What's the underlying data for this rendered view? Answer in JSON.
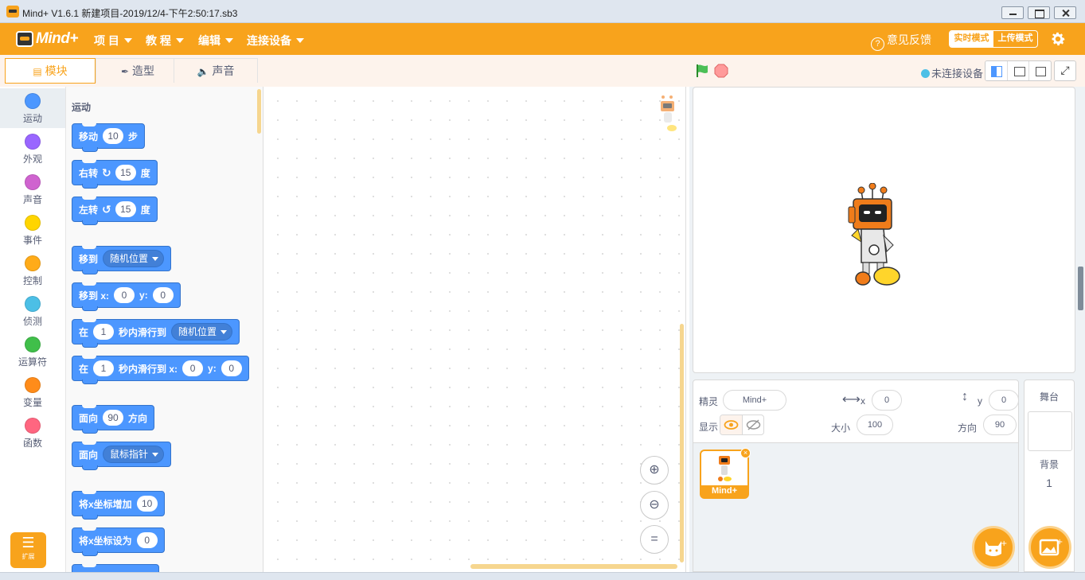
{
  "window": {
    "title": "Mind+ V1.6.1      新建项目-2019/12/4-下午2:50:17.sb3"
  },
  "menubar": {
    "logo_text": "Mind+",
    "items": [
      {
        "label": "项 目"
      },
      {
        "label": "教 程"
      },
      {
        "label": "编辑"
      },
      {
        "label": "连接设备"
      }
    ],
    "feedback_label": "意见反馈",
    "mode_realtime": "实时模式",
    "mode_upload": "上传模式",
    "accent_color": "#f8a31c"
  },
  "tabs": [
    {
      "label": "模块",
      "icon": "blocks-icon",
      "active": true
    },
    {
      "label": "造型",
      "icon": "brush-icon",
      "active": false
    },
    {
      "label": "声音",
      "icon": "speaker-icon",
      "active": false
    }
  ],
  "stage_header": {
    "connection_status": "未连接设备"
  },
  "categories": [
    {
      "label": "运动",
      "color": "#4c97ff"
    },
    {
      "label": "外观",
      "color": "#9966ff"
    },
    {
      "label": "声音",
      "color": "#cf63cf"
    },
    {
      "label": "事件",
      "color": "#ffd500"
    },
    {
      "label": "控制",
      "color": "#ffab19"
    },
    {
      "label": "侦测",
      "color": "#4cbfe6"
    },
    {
      "label": "运算符",
      "color": "#40bf4a"
    },
    {
      "label": "变量",
      "color": "#ff8c1a"
    },
    {
      "label": "函数",
      "color": "#ff6680"
    }
  ],
  "extension": {
    "label": "扩展"
  },
  "palette": {
    "heading": "运动",
    "blocks": {
      "move": {
        "t1": "移动",
        "v1": "10",
        "t2": "步"
      },
      "turn_right": {
        "t1": "右转",
        "v1": "15",
        "t2": "度"
      },
      "turn_left": {
        "t1": "左转",
        "v1": "15",
        "t2": "度"
      },
      "goto": {
        "t1": "移到",
        "d1": "随机位置"
      },
      "goto_xy": {
        "t1": "移到 x:",
        "v1": "0",
        "t2": "y:",
        "v2": "0"
      },
      "glide_to": {
        "t1": "在",
        "v1": "1",
        "t2": "秒内滑行到",
        "d1": "随机位置"
      },
      "glide_xy": {
        "t1": "在",
        "v1": "1",
        "t2": "秒内滑行到 x:",
        "v2": "0",
        "t3": "y:",
        "v3": "0"
      },
      "point_dir": {
        "t1": "面向",
        "v1": "90",
        "t2": "方向"
      },
      "point_towards": {
        "t1": "面向",
        "d1": "鼠标指针"
      },
      "change_x": {
        "t1": "将x坐标增加",
        "v1": "10"
      },
      "set_x": {
        "t1": "将x坐标设为",
        "v1": "0"
      }
    }
  },
  "sprite_info": {
    "sprite_label": "精灵",
    "sprite_name": "Mind+",
    "x_label": "x",
    "x_value": "0",
    "y_label": "y",
    "y_value": "0",
    "show_label": "显示",
    "size_label": "大小",
    "size_value": "100",
    "direction_label": "方向",
    "direction_value": "90"
  },
  "sprites": [
    {
      "name": "Mind+"
    }
  ],
  "stage_panel": {
    "title": "舞台",
    "backdrop_label": "背景",
    "backdrop_count": "1"
  }
}
